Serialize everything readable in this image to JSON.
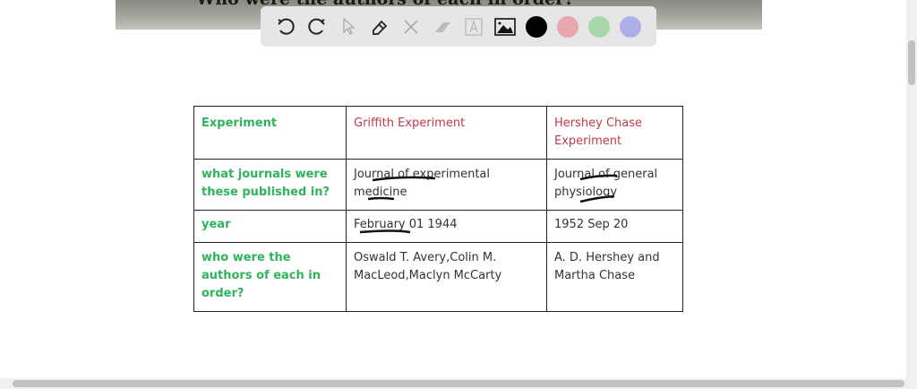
{
  "banner": {
    "text": "Who were the authors of each in order?"
  },
  "toolbar": {
    "tools": [
      "undo-icon",
      "redo-icon",
      "pointer-icon",
      "pen-icon",
      "tools-icon",
      "eraser-icon",
      "text-icon",
      "image-icon"
    ],
    "colors": [
      "#000000",
      "#e8a6ae",
      "#a8d8aa",
      "#b0aee8"
    ]
  },
  "table": {
    "header": [
      "Experiment",
      "Griffith Experiment",
      "Hershey Chase Experiment"
    ],
    "rows": [
      [
        "what journals were these published in?",
        "Journal of experimental medicine",
        "Journal of general physiology"
      ],
      [
        "year",
        "February 01 1944",
        "1952 Sep 20"
      ],
      [
        "who were the authors of each in order?",
        "Oswald T. Avery,Colin M. MacLeod,Maclyn McCarty",
        "A. D. Hershey and Martha Chase"
      ]
    ]
  },
  "colors": {
    "label": "#2fb35c",
    "heading": "#c0394b"
  }
}
